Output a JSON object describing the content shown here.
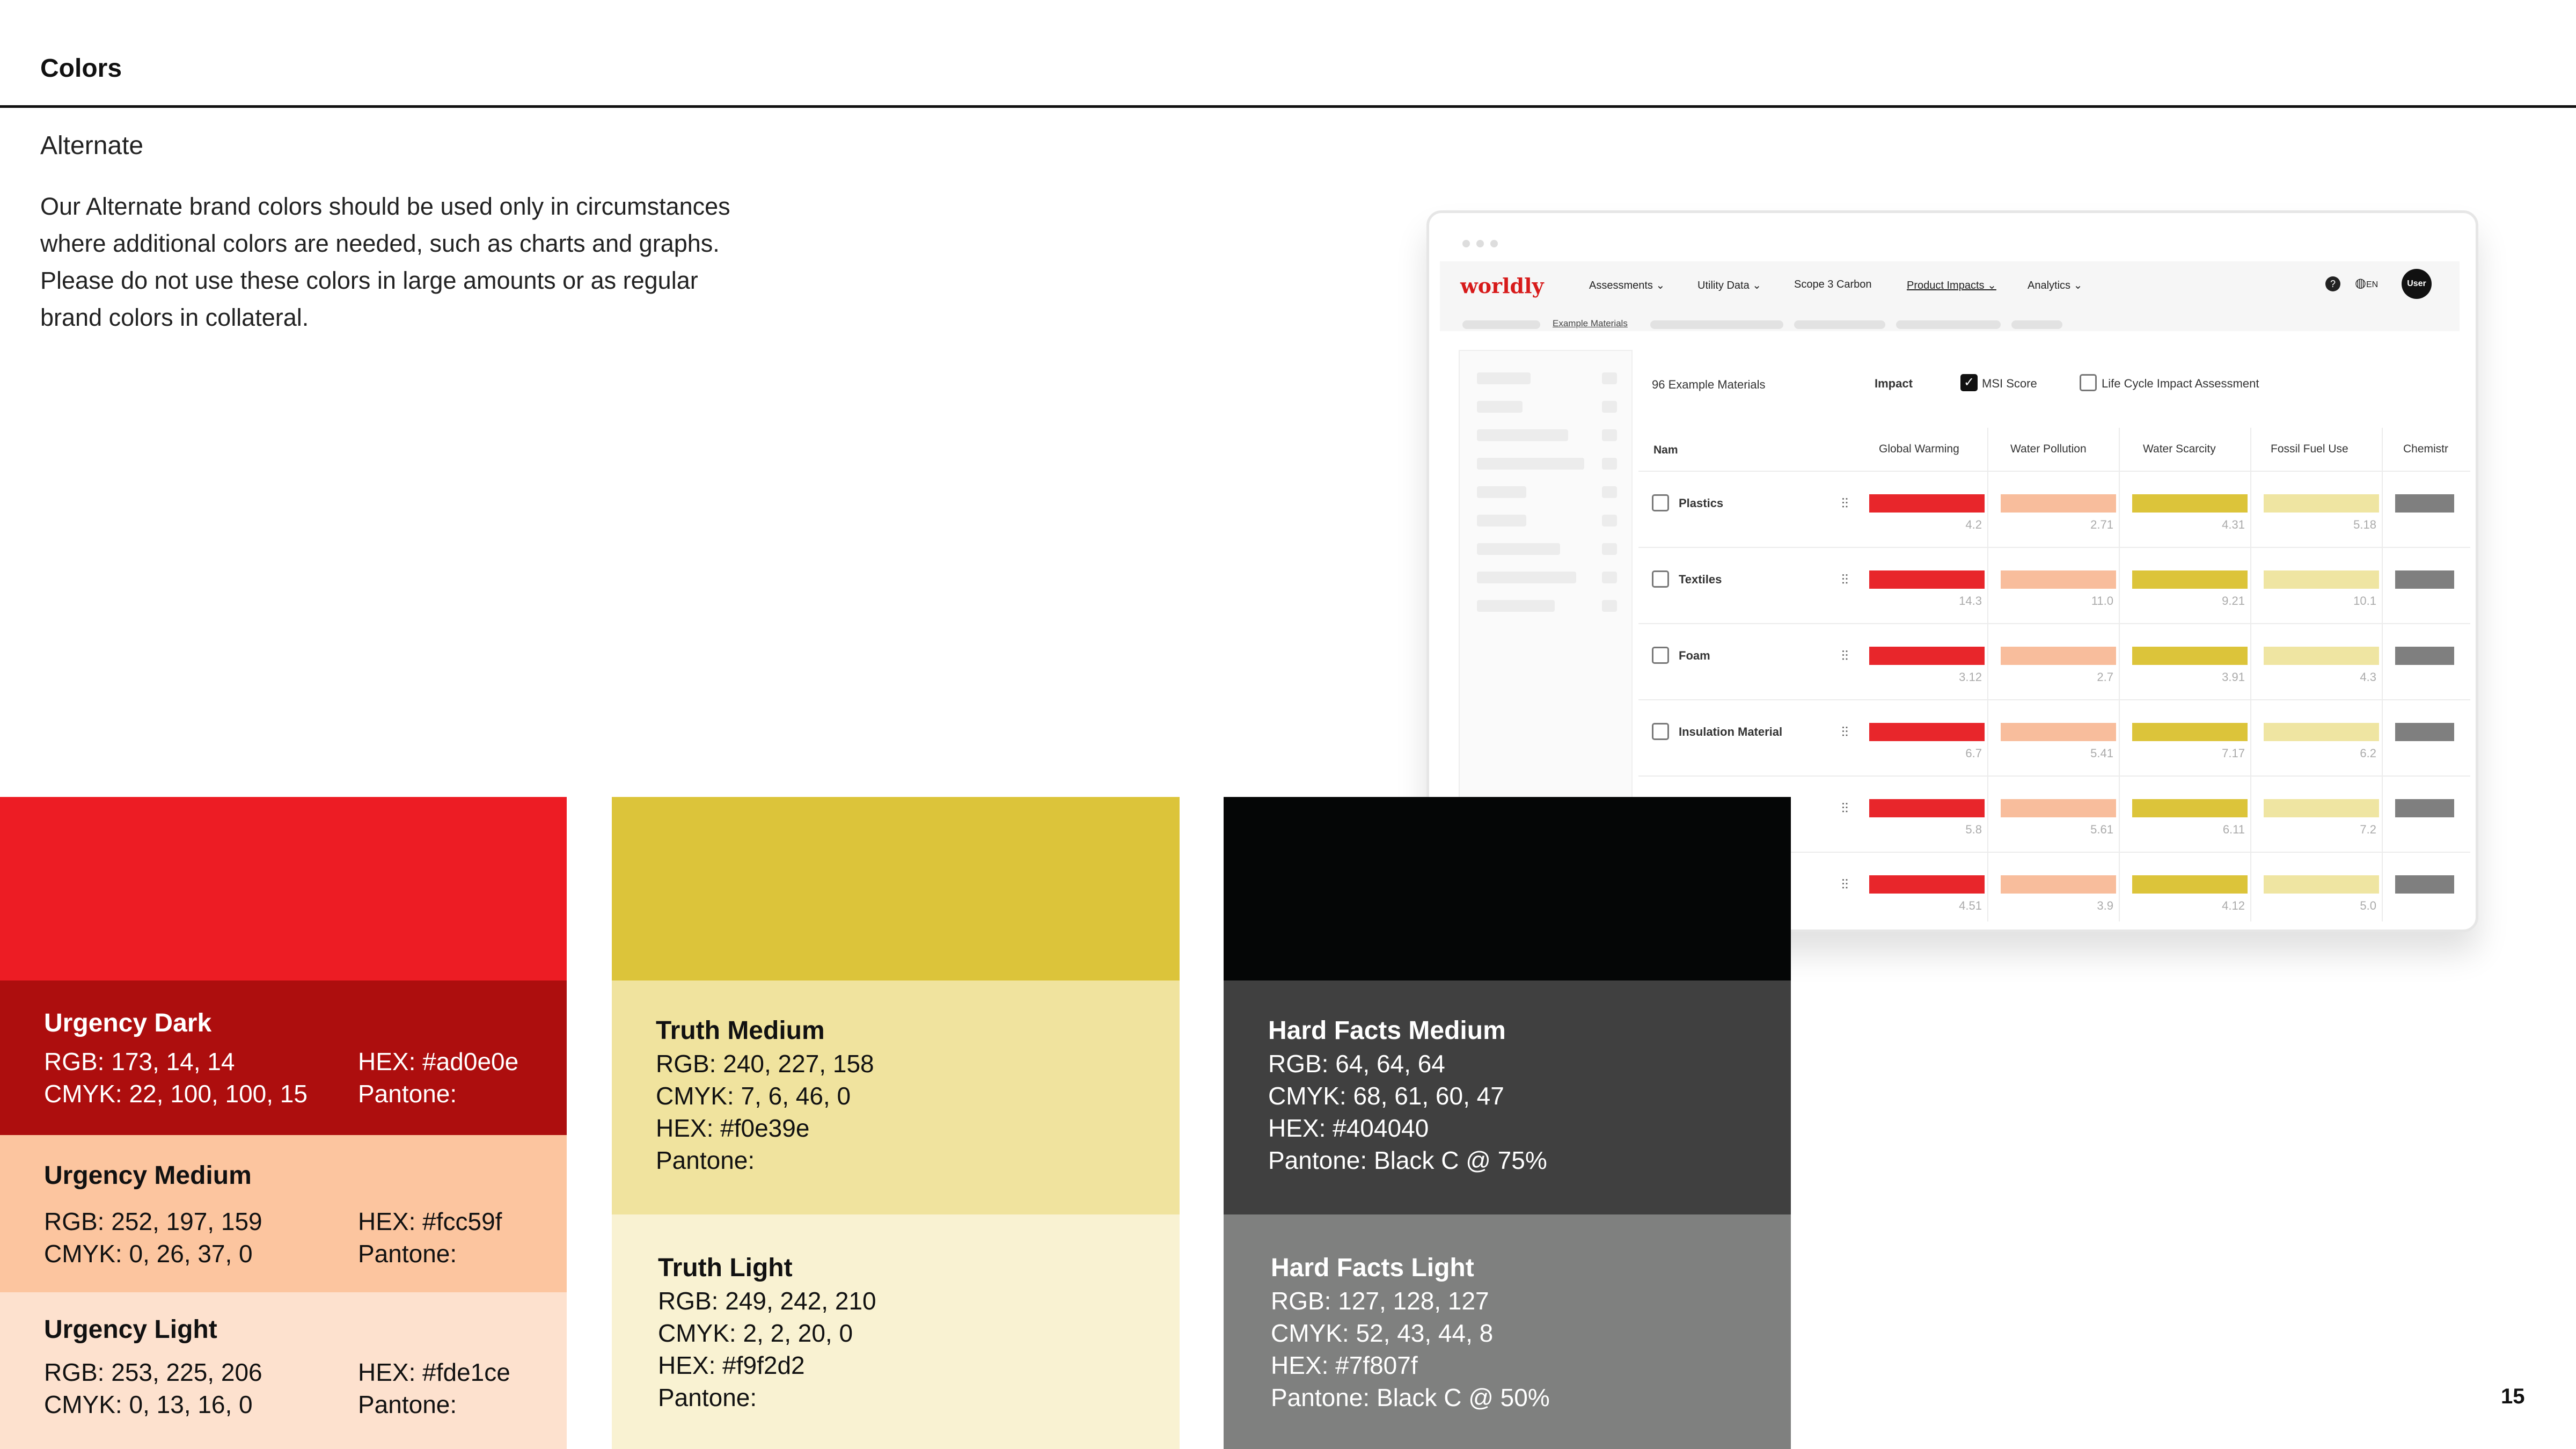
{
  "page": {
    "heading": "Colors",
    "subheading": "Alternate",
    "body": "Our Alternate brand colors should be used only in circumstances where additional colors are needed, such as charts and graphs. Please do not use these colors in large amounts or as regular brand colors in collateral.",
    "page_number": "15"
  },
  "colors": {
    "urgency_top": "#ed1c24",
    "urgency_dark": "#ad0e0e",
    "urgency_medium": "#fcc59f",
    "urgency_light": "#fde1ce",
    "truth_top": "#dcc43a",
    "truth_medium": "#f0e39e",
    "truth_light": "#f9f2d2",
    "hard_top": "#050606",
    "hard_medium": "#404040",
    "hard_light": "#7f807f",
    "mock_red": "#e8262b",
    "mock_peach": "#f8bd9c",
    "mock_yellow": "#dcc43a",
    "mock_pale": "#efe5a2",
    "mock_gray": "#7f7f7f"
  },
  "swatches": {
    "urgency_dark": {
      "name": "Urgency Dark",
      "rgb": "RGB: 173, 14, 14",
      "hex": "HEX: #ad0e0e",
      "cmyk": "CMYK: 22, 100, 100, 15",
      "pantone": "Pantone:"
    },
    "urgency_medium": {
      "name": "Urgency Medium",
      "rgb": "RGB: 252, 197, 159",
      "hex": "HEX: #fcc59f",
      "cmyk": "CMYK: 0, 26, 37, 0",
      "pantone": "Pantone:"
    },
    "urgency_light": {
      "name": "Urgency Light",
      "rgb": "RGB: 253, 225, 206",
      "hex": "HEX: #fde1ce",
      "cmyk": "CMYK: 0, 13, 16, 0",
      "pantone": "Pantone:"
    },
    "truth_medium": {
      "name": "Truth Medium",
      "rgb": "RGB: 240, 227, 158",
      "cmyk": "CMYK: 7, 6, 46, 0",
      "hex": "HEX: #f0e39e",
      "pantone": "Pantone:"
    },
    "truth_light": {
      "name": "Truth Light",
      "rgb": "RGB: 249, 242, 210",
      "cmyk": "CMYK: 2, 2, 20, 0",
      "hex": "HEX: #f9f2d2",
      "pantone": "Pantone:"
    },
    "hard_medium": {
      "name": "Hard Facts Medium",
      "rgb": "RGB: 64, 64, 64",
      "cmyk": "CMYK: 68, 61, 60, 47",
      "hex": "HEX: #404040",
      "pantone": "Pantone: Black C @ 75%"
    },
    "hard_light": {
      "name": "Hard Facts Light",
      "rgb": "RGB: 127, 128, 127",
      "cmyk": "CMYK: 52, 43, 44, 8",
      "hex": "HEX: #7f807f",
      "pantone": "Pantone: Black C @ 50%"
    }
  },
  "mockup": {
    "logo": "worldly",
    "nav": [
      "Assessments",
      "Utility Data",
      "Scope 3 Carbon",
      "Product Impacts",
      "Analytics"
    ],
    "lang": "EN",
    "user": "User",
    "breadcrumb": "Example Materials",
    "count": "96 Example Materials",
    "impact_label": "Impact",
    "msi_label": "MSI Score",
    "lca_label": "Life Cycle Impact Assessment",
    "name_header": "Nam",
    "columns": [
      "Global Warming",
      "Water Pollution",
      "Water Scarcity",
      "Fossil Fuel Use",
      "Chemistr"
    ],
    "rows": [
      {
        "name": "Plastics",
        "values": [
          "4.2",
          "2.71",
          "4.31",
          "5.18"
        ]
      },
      {
        "name": "Textiles",
        "values": [
          "14.3",
          "11.0",
          "9.21",
          "10.1"
        ]
      },
      {
        "name": "Foam",
        "values": [
          "3.12",
          "2.7",
          "3.91",
          "4.3"
        ]
      },
      {
        "name": "Insulation Material",
        "values": [
          "6.7",
          "5.41",
          "7.17",
          "6.2"
        ]
      },
      {
        "name": "",
        "values": [
          "5.8",
          "5.61",
          "6.11",
          "7.2"
        ]
      },
      {
        "name": "",
        "values": [
          "4.51",
          "3.9",
          "4.12",
          "5.0"
        ]
      }
    ]
  }
}
